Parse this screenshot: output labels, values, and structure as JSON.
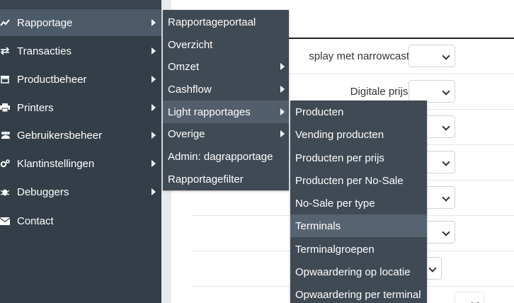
{
  "sidebar": {
    "items": [
      {
        "label": "Rapportage",
        "icon": "chart-line-icon",
        "has_submenu": true,
        "active": true
      },
      {
        "label": "Transacties",
        "icon": "exchange-icon",
        "has_submenu": true
      },
      {
        "label": "Productbeheer",
        "icon": "store-icon",
        "has_submenu": true
      },
      {
        "label": "Printers",
        "icon": "printer-icon",
        "has_submenu": true
      },
      {
        "label": "Gebruikersbeheer",
        "icon": "users-icon",
        "has_submenu": true
      },
      {
        "label": "Klantinstellingen",
        "icon": "cogs-icon",
        "has_submenu": true
      },
      {
        "label": "Debuggers",
        "icon": "bug-icon",
        "has_submenu": true
      },
      {
        "label": "Contact",
        "icon": "envelope-icon",
        "has_submenu": false
      }
    ]
  },
  "rapportage_menu": {
    "items": [
      {
        "label": "Rapportageportaal",
        "has_submenu": false
      },
      {
        "label": "Overzicht",
        "has_submenu": false
      },
      {
        "label": "Omzet",
        "has_submenu": true
      },
      {
        "label": "Cashflow",
        "has_submenu": true
      },
      {
        "label": "Light rapportages",
        "has_submenu": true,
        "active": true
      },
      {
        "label": "Overige",
        "has_submenu": true
      },
      {
        "label": "Admin: dagrapportage",
        "has_submenu": false
      },
      {
        "label": "Rapportagefilter",
        "has_submenu": false
      }
    ]
  },
  "light_menu": {
    "items": [
      {
        "label": "Producten"
      },
      {
        "label": "Vending producten"
      },
      {
        "label": "Producten per prijs"
      },
      {
        "label": "Producten per No-Sale"
      },
      {
        "label": "No-Sale per type"
      },
      {
        "label": "Terminals",
        "active": true
      },
      {
        "label": "Terminalgroepen"
      },
      {
        "label": "Opwaardering op locatie"
      },
      {
        "label": "Opwaardering per terminal"
      }
    ]
  },
  "form": {
    "rows": [
      {
        "label": "splay met narrowcasting"
      },
      {
        "label": "Digitale prijslijst"
      }
    ]
  },
  "colors": {
    "sidebar_bg": "#343e48",
    "menu_bg": "#404a55",
    "active_bg": "#4d5a68"
  }
}
